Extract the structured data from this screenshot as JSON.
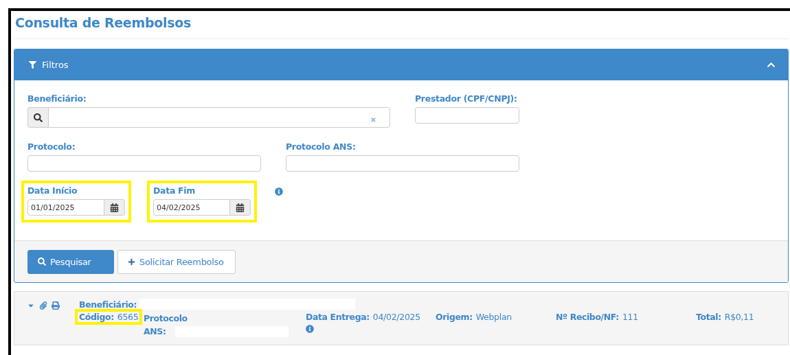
{
  "page": {
    "title": "Consulta de Reembolsos"
  },
  "filters": {
    "title": "Filtros",
    "expanded": true,
    "rows": [
      {
        "fields": [
          {
            "kind": "search",
            "label": "Beneficiário:",
            "highlighted": false,
            "info": false
          },
          {
            "kind": "text",
            "label": "Prestador (CPF/CNPJ):",
            "highlighted": false,
            "info": false
          }
        ]
      },
      {
        "fields": [
          {
            "kind": "text",
            "label": "Protocolo:",
            "highlighted": false,
            "info": false
          },
          {
            "kind": "text",
            "label": "Protocolo ANS:",
            "highlighted": false,
            "info": false
          }
        ]
      },
      {
        "fields": [
          {
            "kind": "date",
            "label": "Data Início",
            "value": "01/01/2025",
            "highlighted": true,
            "info": false
          },
          {
            "kind": "date",
            "label": "Data Fim",
            "value": "04/02/2025",
            "highlighted": true,
            "info": true
          }
        ]
      }
    ],
    "buttons": [
      {
        "kind": "primary",
        "label": "Pesquisar"
      },
      {
        "kind": "secondary",
        "label": "Solicitar Reembolso"
      }
    ]
  },
  "results": [
    {
      "beneficiary_label": "Beneficiário:",
      "beneficiary_redacted": true,
      "fields": [
        {
          "label": "Código:",
          "value": "6565",
          "highlighted": true,
          "redacted": false,
          "info": false
        },
        {
          "label": "Protocolo ANS:",
          "highlighted": false,
          "redacted": true,
          "info": false
        },
        {
          "label": "Data Entrega:",
          "value": "04/02/2025",
          "highlighted": false,
          "redacted": false,
          "info": true
        },
        {
          "label": "Origem:",
          "value": "Webplan",
          "highlighted": false,
          "redacted": false,
          "info": false
        },
        {
          "label": "Nº Recibo/NF:",
          "value": "111",
          "highlighted": false,
          "redacted": false,
          "info": false
        },
        {
          "label": "Total:",
          "value": "R$0,11",
          "highlighted": false,
          "redacted": false,
          "info": false
        }
      ]
    }
  ]
}
